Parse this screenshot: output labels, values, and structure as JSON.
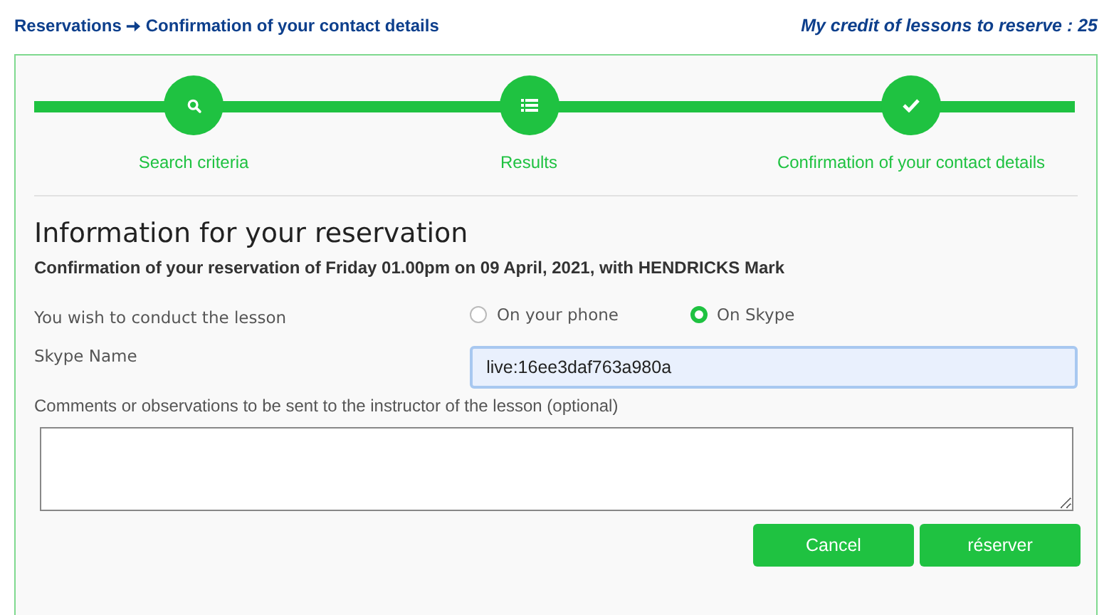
{
  "breadcrumb": {
    "parent": "Reservations",
    "current": "Confirmation of your contact details"
  },
  "credit": "My credit of lessons to reserve : 25",
  "steps": [
    {
      "label": "Search criteria",
      "kind": "search"
    },
    {
      "label": "Results",
      "kind": "list"
    },
    {
      "label": "Confirmation of your contact details",
      "kind": "check"
    }
  ],
  "heading": "Information for your reservation",
  "subtitle": "Confirmation of your reservation of Friday 01.00pm on 09 April, 2021, with HENDRICKS Mark",
  "mode": {
    "label": "You wish to conduct the lesson",
    "options": [
      {
        "label": "On your phone",
        "selected": false
      },
      {
        "label": "On Skype",
        "selected": true
      }
    ]
  },
  "skype": {
    "label": "Skype Name",
    "value": "live:16ee3daf763a980a"
  },
  "comments": {
    "label": "Comments or observations to be sent to the instructor of the lesson (optional)"
  },
  "buttons": [
    "Cancel",
    "réserver"
  ]
}
